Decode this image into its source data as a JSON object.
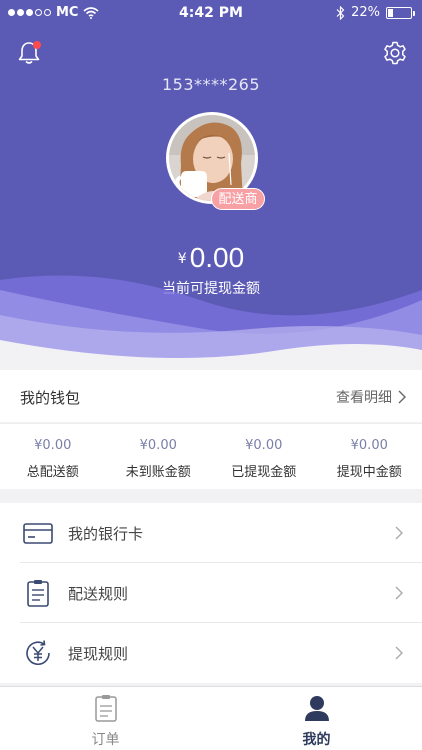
{
  "status_bar": {
    "carrier": "MC",
    "time": "4:42 PM",
    "battery": "22%",
    "battery_level": 0.22
  },
  "profile": {
    "phone": "153****265",
    "role_badge": "配送商",
    "balance_currency": "¥",
    "balance": "0.00",
    "balance_label": "当前可提现金额"
  },
  "wallet": {
    "title": "我的钱包",
    "detail_link": "查看明细",
    "stats": [
      {
        "value": "¥0.00",
        "label": "总配送额"
      },
      {
        "value": "¥0.00",
        "label": "未到账金额"
      },
      {
        "value": "¥0.00",
        "label": "已提现金额"
      },
      {
        "value": "¥0.00",
        "label": "提现中金额"
      }
    ]
  },
  "menu": {
    "items": [
      {
        "label": "我的银行卡",
        "icon": "bank-card-icon"
      },
      {
        "label": "配送规则",
        "icon": "clipboard-icon"
      },
      {
        "label": "提现规则",
        "icon": "yen-refresh-icon"
      }
    ]
  },
  "tabbar": {
    "tabs": [
      {
        "label": "订单",
        "icon": "order-icon",
        "active": false
      },
      {
        "label": "我的",
        "icon": "user-icon",
        "active": true
      }
    ]
  },
  "colors": {
    "header": "#5b5ab5",
    "badge": "#f7a1a5",
    "notification_dot": "#ff4b4b",
    "accent_dark": "#2e3a5e"
  }
}
